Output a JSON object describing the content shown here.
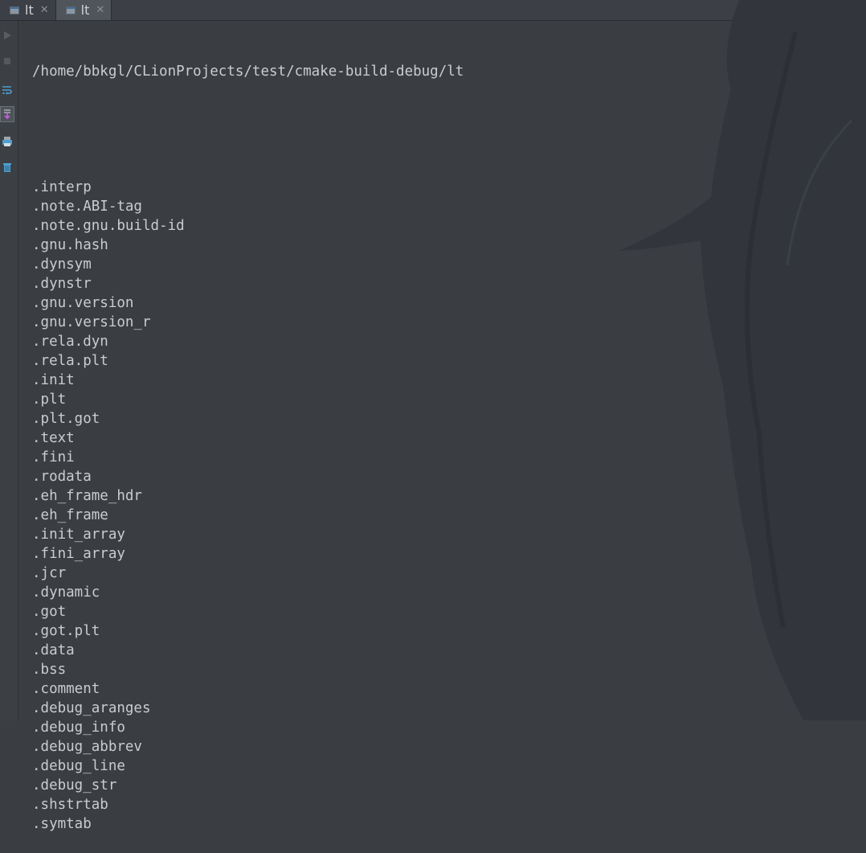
{
  "tabs": [
    {
      "label": "lt",
      "icon": "terminal-icon",
      "active": false
    },
    {
      "label": "lt",
      "icon": "terminal-icon",
      "active": true
    }
  ],
  "gutter_icons": [
    "run-icon",
    "stop-icon",
    "soft-wrap-icon",
    "scroll-to-end-icon",
    "print-icon",
    "trash-icon"
  ],
  "output": {
    "path": "/home/bbkgl/CLionProjects/test/cmake-build-debug/lt",
    "sections": [
      ".interp",
      ".note.ABI-tag",
      ".note.gnu.build-id",
      ".gnu.hash",
      ".dynsym",
      ".dynstr",
      ".gnu.version",
      ".gnu.version_r",
      ".rela.dyn",
      ".rela.plt",
      ".init",
      ".plt",
      ".plt.got",
      ".text",
      ".fini",
      ".rodata",
      ".eh_frame_hdr",
      ".eh_frame",
      ".init_array",
      ".fini_array",
      ".jcr",
      ".dynamic",
      ".got",
      ".got.plt",
      ".data",
      ".bss",
      ".comment",
      ".debug_aranges",
      ".debug_info",
      ".debug_abbrev",
      ".debug_line",
      ".debug_str",
      ".shstrtab",
      ".symtab"
    ]
  }
}
